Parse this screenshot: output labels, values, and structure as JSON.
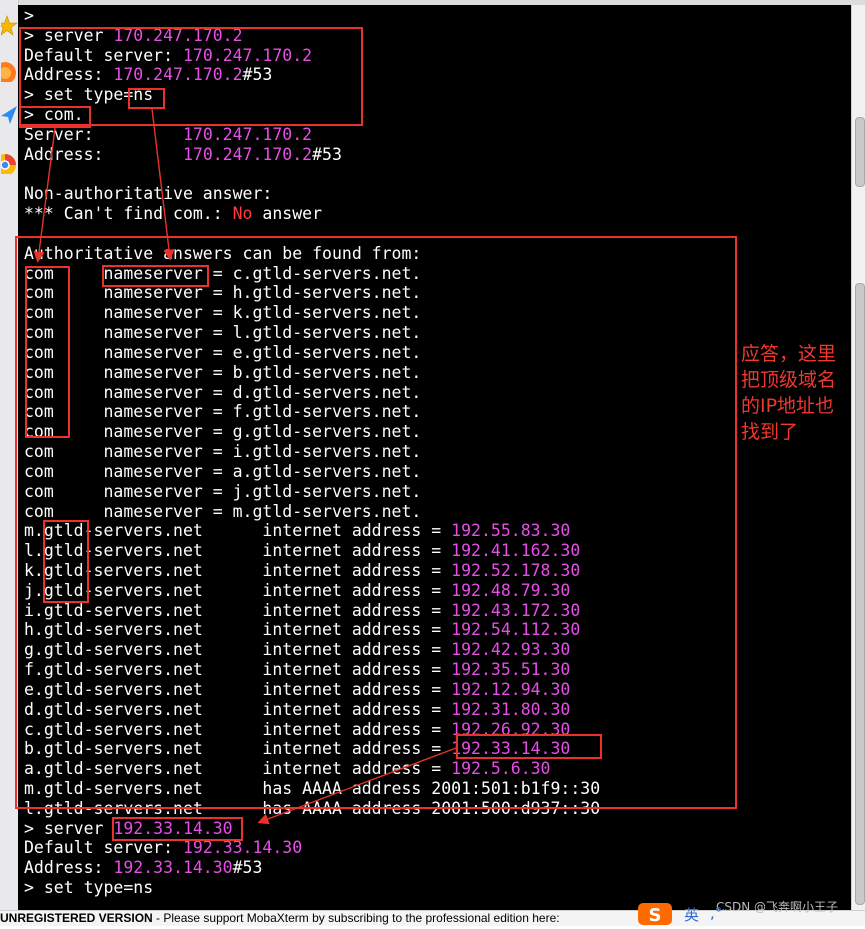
{
  "terminal": {
    "lines": [
      {
        "text": ">"
      },
      {
        "parts": [
          {
            "t": "> server "
          },
          {
            "t": "170.247.170.2",
            "c": "mag"
          }
        ]
      },
      {
        "parts": [
          {
            "t": "Default server: "
          },
          {
            "t": "170.247.170.2",
            "c": "mag"
          }
        ]
      },
      {
        "parts": [
          {
            "t": "Address: "
          },
          {
            "t": "170.247.170.2",
            "c": "mag"
          },
          {
            "t": "#53"
          }
        ]
      },
      {
        "text": "> set type=ns"
      },
      {
        "text": "> com."
      },
      {
        "parts": [
          {
            "t": "Server:         "
          },
          {
            "t": "170.247.170.2",
            "c": "mag"
          }
        ]
      },
      {
        "parts": [
          {
            "t": "Address:        "
          },
          {
            "t": "170.247.170.2",
            "c": "mag"
          },
          {
            "t": "#53"
          }
        ]
      },
      {
        "text": ""
      },
      {
        "text": "Non-authoritative answer:"
      },
      {
        "parts": [
          {
            "t": "*** Can't find com.: "
          },
          {
            "t": "No",
            "c": "red"
          },
          {
            "t": " answer"
          }
        ]
      },
      {
        "text": ""
      },
      {
        "text": "Authoritative answers can be found from:"
      },
      {
        "text": "com     nameserver = c.gtld-servers.net."
      },
      {
        "text": "com     nameserver = h.gtld-servers.net."
      },
      {
        "text": "com     nameserver = k.gtld-servers.net."
      },
      {
        "text": "com     nameserver = l.gtld-servers.net."
      },
      {
        "text": "com     nameserver = e.gtld-servers.net."
      },
      {
        "text": "com     nameserver = b.gtld-servers.net."
      },
      {
        "text": "com     nameserver = d.gtld-servers.net."
      },
      {
        "text": "com     nameserver = f.gtld-servers.net."
      },
      {
        "text": "com     nameserver = g.gtld-servers.net."
      },
      {
        "text": "com     nameserver = i.gtld-servers.net."
      },
      {
        "text": "com     nameserver = a.gtld-servers.net."
      },
      {
        "text": "com     nameserver = j.gtld-servers.net."
      },
      {
        "text": "com     nameserver = m.gtld-servers.net."
      },
      {
        "parts": [
          {
            "t": "m.gtld-servers.net      internet address = "
          },
          {
            "t": "192.55.83.30",
            "c": "mag"
          }
        ]
      },
      {
        "parts": [
          {
            "t": "l.gtld-servers.net      internet address = "
          },
          {
            "t": "192.41.162.30",
            "c": "mag"
          }
        ]
      },
      {
        "parts": [
          {
            "t": "k.gtld-servers.net      internet address = "
          },
          {
            "t": "192.52.178.30",
            "c": "mag"
          }
        ]
      },
      {
        "parts": [
          {
            "t": "j.gtld-servers.net      internet address = "
          },
          {
            "t": "192.48.79.30",
            "c": "mag"
          }
        ]
      },
      {
        "parts": [
          {
            "t": "i.gtld-servers.net      internet address = "
          },
          {
            "t": "192.43.172.30",
            "c": "mag"
          }
        ]
      },
      {
        "parts": [
          {
            "t": "h.gtld-servers.net      internet address = "
          },
          {
            "t": "192.54.112.30",
            "c": "mag"
          }
        ]
      },
      {
        "parts": [
          {
            "t": "g.gtld-servers.net      internet address = "
          },
          {
            "t": "192.42.93.30",
            "c": "mag"
          }
        ]
      },
      {
        "parts": [
          {
            "t": "f.gtld-servers.net      internet address = "
          },
          {
            "t": "192.35.51.30",
            "c": "mag"
          }
        ]
      },
      {
        "parts": [
          {
            "t": "e.gtld-servers.net      internet address = "
          },
          {
            "t": "192.12.94.30",
            "c": "mag"
          }
        ]
      },
      {
        "parts": [
          {
            "t": "d.gtld-servers.net      internet address = "
          },
          {
            "t": "192.31.80.30",
            "c": "mag"
          }
        ]
      },
      {
        "parts": [
          {
            "t": "c.gtld-servers.net      internet address = "
          },
          {
            "t": "192.26.92.30",
            "c": "mag"
          }
        ]
      },
      {
        "parts": [
          {
            "t": "b.gtld-servers.net      internet address = "
          },
          {
            "t": "192.33.14.30",
            "c": "mag"
          }
        ]
      },
      {
        "parts": [
          {
            "t": "a.gtld-servers.net      internet address = "
          },
          {
            "t": "192.5.6.30",
            "c": "mag"
          }
        ]
      },
      {
        "text": "m.gtld-servers.net      has AAAA address 2001:501:b1f9::30"
      },
      {
        "text": "l.gtld-servers.net      has AAAA address 2001:500:d937::30"
      },
      {
        "parts": [
          {
            "t": "> server "
          },
          {
            "t": "192.33.14.30",
            "c": "mag"
          }
        ]
      },
      {
        "parts": [
          {
            "t": "Default server: "
          },
          {
            "t": "192.33.14.30",
            "c": "mag"
          }
        ]
      },
      {
        "parts": [
          {
            "t": "Address: "
          },
          {
            "t": "192.33.14.30",
            "c": "mag"
          },
          {
            "t": "#53"
          }
        ]
      },
      {
        "text": "> set type=ns"
      }
    ]
  },
  "annotation": {
    "lines": [
      "应答，这里",
      "把顶级域名",
      "的IP地址也",
      "找到了"
    ]
  },
  "statusbar": {
    "bold": "UNREGISTERED VERSION",
    "message": "  -  Please support MobaXterm by subscribing to the professional edition here:"
  },
  "ime": {
    "label": "英"
  },
  "watermark": "CSDN @飞奔啊小王子",
  "colors": {
    "background": "#000000",
    "text": "#ffffff",
    "ip_highlight": "#e64ee6",
    "no_keyword": "#ff3b3b",
    "annotation": "#f0382f"
  },
  "icons": [
    "star-icon",
    "firefox-icon",
    "send-icon",
    "chrome-icon",
    "sogou-ime-icon"
  ]
}
